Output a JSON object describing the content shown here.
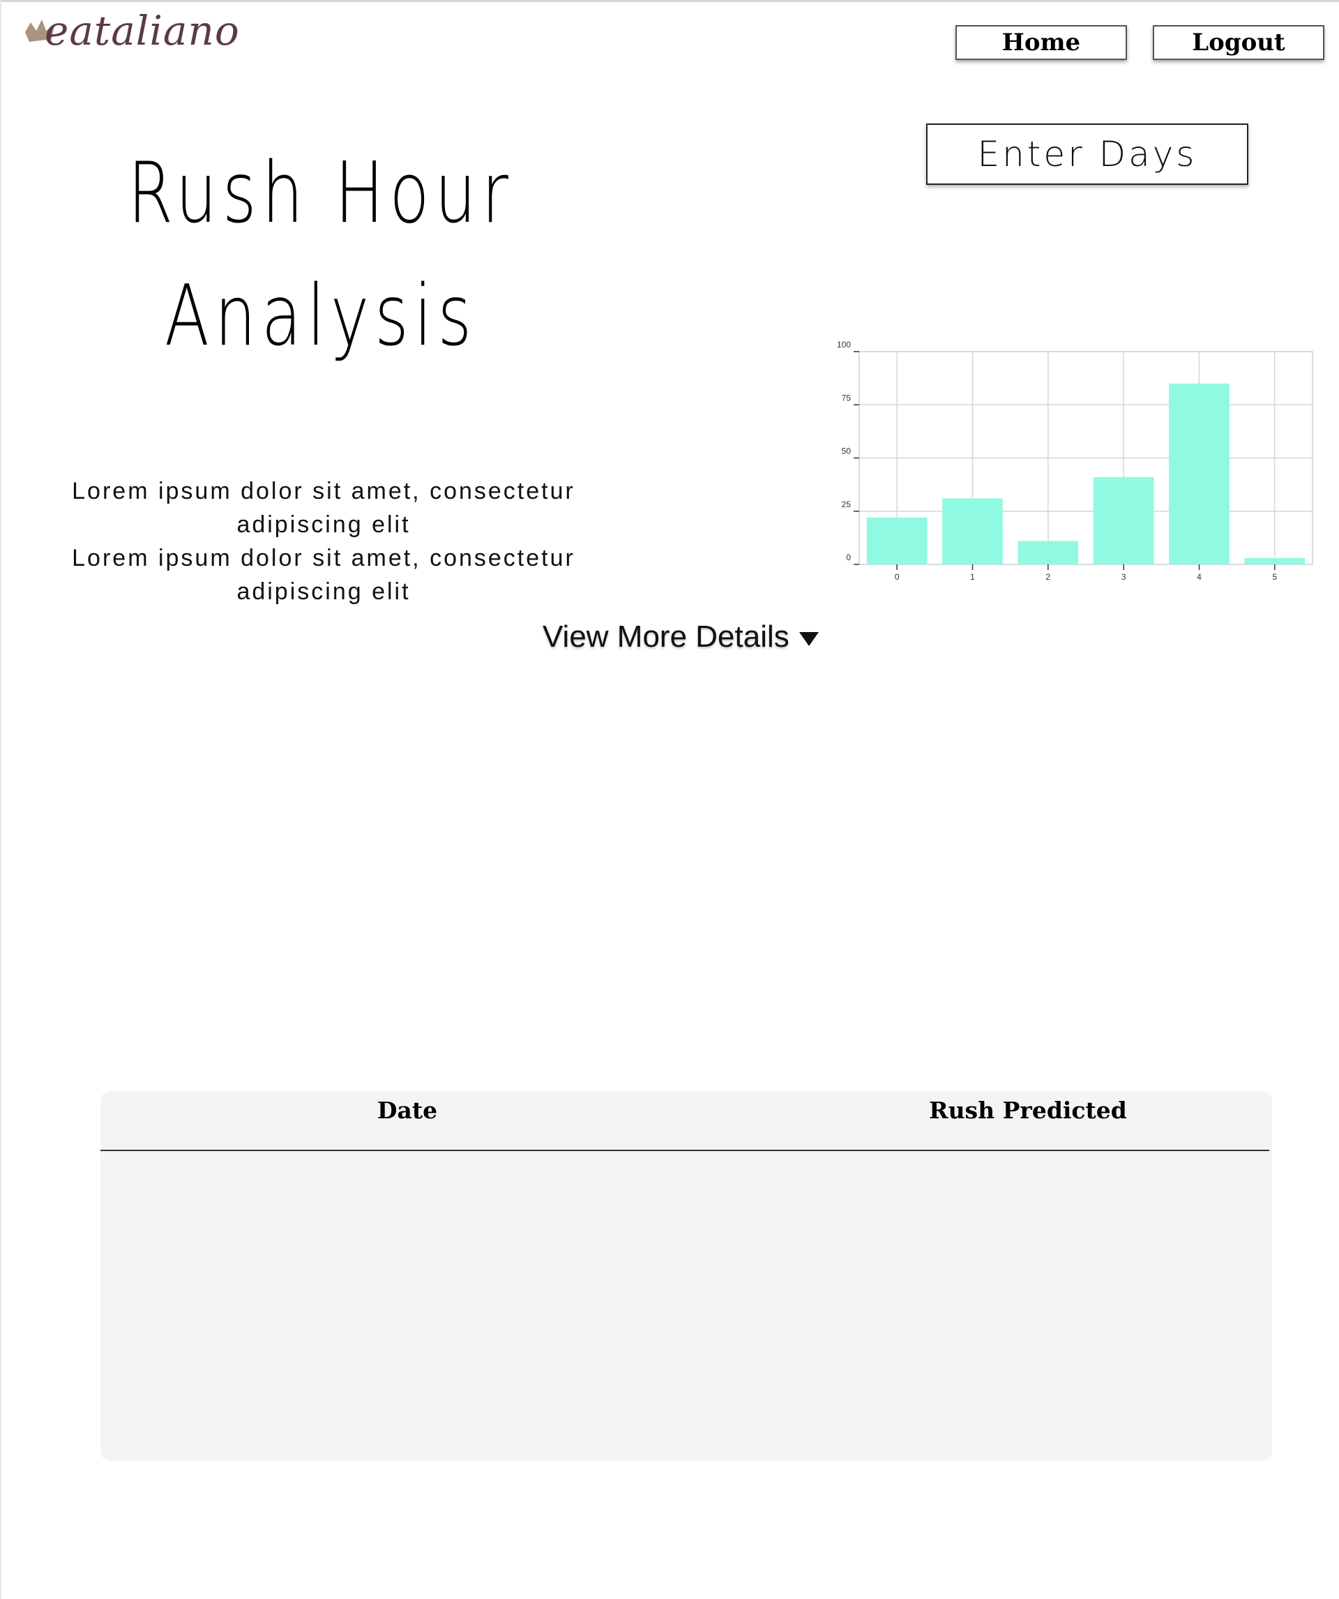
{
  "brand": {
    "logo_text": "eataliano"
  },
  "nav": {
    "home_label": "Home",
    "logout_label": "Logout"
  },
  "page": {
    "title_line1": "Rush Hour",
    "title_line2": "Analysis",
    "intro_lines": [
      "Lorem ipsum dolor sit amet, consectetur",
      "adipiscing elit",
      "Lorem ipsum dolor sit amet, consectetur",
      "adipiscing elit"
    ],
    "view_more_label": "View More Details"
  },
  "days_input": {
    "placeholder": "Enter Days"
  },
  "table": {
    "headers": [
      "Date",
      "Rush Predicted"
    ],
    "rows": []
  },
  "colors": {
    "bar": "#8ff9e2",
    "brand": "#5b3a46",
    "panel": "#f4f4f4"
  },
  "icons": {
    "logo": "crown-icon",
    "view_more": "caret-down-icon"
  },
  "chart_data": {
    "type": "bar",
    "categories": [
      "0",
      "1",
      "2",
      "3",
      "4",
      "5"
    ],
    "values": [
      22,
      31,
      11,
      41,
      85,
      3
    ],
    "ylim": [
      0,
      100
    ],
    "yticks": [
      0,
      25,
      50,
      75,
      100
    ],
    "grid": true
  }
}
